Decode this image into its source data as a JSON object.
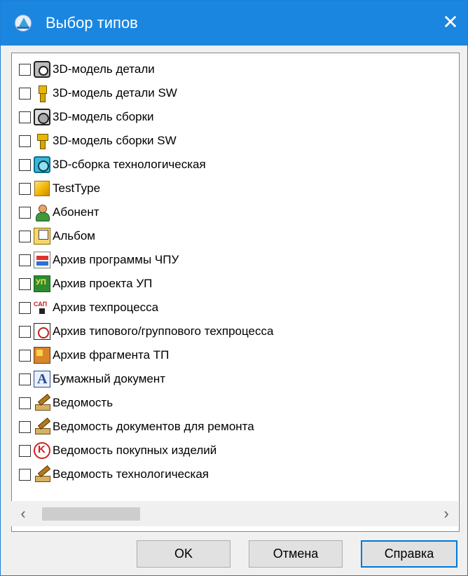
{
  "window": {
    "title": "Выбор типов",
    "close_glyph": "✕"
  },
  "list": {
    "items": [
      {
        "label": "3D-модель детали",
        "icon": "part-3d-icon",
        "checked": false
      },
      {
        "label": "3D-модель детали SW",
        "icon": "part-sw-icon",
        "checked": false
      },
      {
        "label": "3D-модель сборки",
        "icon": "assembly-3d-icon",
        "checked": false
      },
      {
        "label": "3D-модель сборки SW",
        "icon": "assembly-sw-icon",
        "checked": false
      },
      {
        "label": "3D-сборка технологическая",
        "icon": "tech-assembly-icon",
        "checked": false
      },
      {
        "label": "TestType",
        "icon": "cube-icon",
        "checked": false
      },
      {
        "label": "Абонент",
        "icon": "user-icon",
        "checked": false
      },
      {
        "label": "Альбом",
        "icon": "album-icon",
        "checked": false
      },
      {
        "label": "Архив программы ЧПУ",
        "icon": "cnc-archive-icon",
        "checked": false
      },
      {
        "label": "Архив проекта УП",
        "icon": "up-project-icon",
        "checked": false
      },
      {
        "label": "Архив техпроцесса",
        "icon": "sapr-icon",
        "checked": false
      },
      {
        "label": "Архив типового/группового техпроцесса",
        "icon": "typical-process-icon",
        "checked": false
      },
      {
        "label": "Архив фрагмента ТП",
        "icon": "fragment-icon",
        "checked": false
      },
      {
        "label": "Бумажный документ",
        "icon": "paper-document-icon",
        "checked": false
      },
      {
        "label": "Ведомость",
        "icon": "statement-icon",
        "checked": false
      },
      {
        "label": "Ведомость документов для ремонта",
        "icon": "statement-icon",
        "checked": false
      },
      {
        "label": "Ведомость покупных изделий",
        "icon": "purchased-items-icon",
        "checked": false
      },
      {
        "label": "Ведомость технологическая",
        "icon": "statement-icon",
        "checked": false
      }
    ]
  },
  "scrollbar": {
    "left_arrow": "‹",
    "right_arrow": "›"
  },
  "buttons": {
    "ok_label": "OK",
    "cancel_label": "Отмена",
    "help_label": "Справка"
  }
}
